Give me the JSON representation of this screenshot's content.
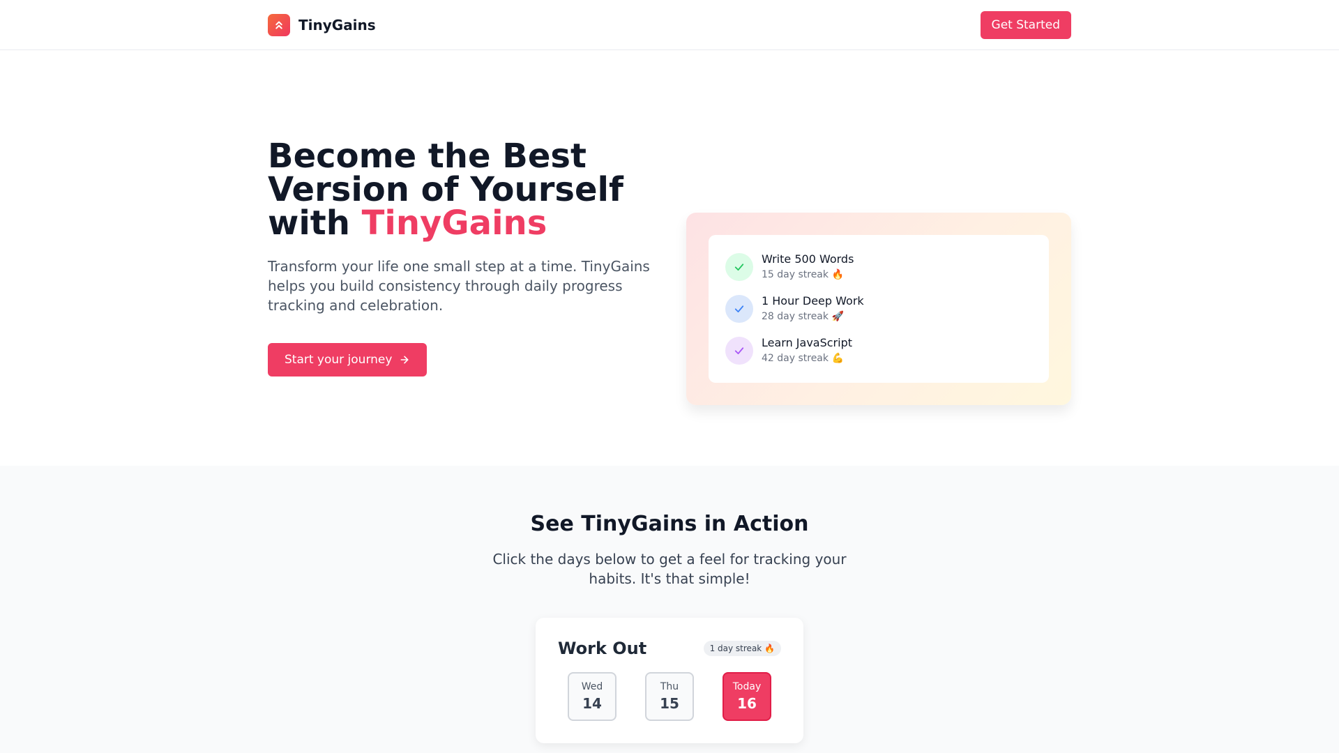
{
  "header": {
    "brand": "TinyGains",
    "get_started": "Get Started"
  },
  "hero": {
    "title_line1": "Become the Best",
    "title_line2": "Version of Yourself",
    "title_with": "with ",
    "title_accent": "TinyGains",
    "description": "Transform your life one small step at a time. TinyGains helps you build consistency through daily progress tracking and celebration.",
    "cta": "Start your journey"
  },
  "habits": [
    {
      "name": "Write 500 Words",
      "streak": "15 day streak 🔥",
      "color": "#22c55e",
      "bg": "#dcfce7"
    },
    {
      "name": "1 Hour Deep Work",
      "streak": "28 day streak 🚀",
      "color": "#3b82f6",
      "bg": "#dbe7fb"
    },
    {
      "name": "Learn JavaScript",
      "streak": "42 day streak 💪",
      "color": "#a855f7",
      "bg": "#f0e2fc"
    }
  ],
  "action": {
    "title": "See TinyGains in Action",
    "description": "Click the days below to get a feel for tracking your habits. It's that simple!",
    "demo": {
      "habit": "Work Out",
      "streak": "1 day streak 🔥",
      "days": [
        {
          "name": "Wed",
          "num": "14",
          "active": false
        },
        {
          "name": "Thu",
          "num": "15",
          "active": false
        },
        {
          "name": "Today",
          "num": "16",
          "active": true
        }
      ]
    }
  },
  "colors": {
    "accent": "#ef3d63",
    "logo_gradient": [
      "#f56a3c",
      "#f0385e"
    ]
  },
  "icons": {
    "logo": "chevrons-up-icon",
    "cta_arrow": "arrow-right-icon",
    "habit_check": "check-icon"
  }
}
